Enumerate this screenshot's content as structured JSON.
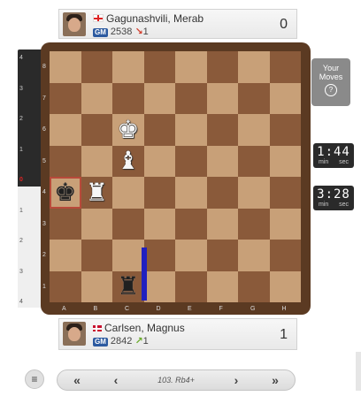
{
  "players": {
    "top": {
      "name": "Gagunashvili, Merab",
      "title": "GM",
      "rating": "2538",
      "rating_change": "1",
      "rating_dir": "down",
      "score": "0",
      "flag": "georgia"
    },
    "bottom": {
      "name": "Carlsen, Magnus",
      "title": "GM",
      "rating": "2842",
      "rating_change": "1",
      "rating_dir": "up",
      "score": "1",
      "flag": "norway"
    }
  },
  "eval_bar": {
    "marks": [
      "4",
      "3",
      "2",
      "1",
      "0",
      "1",
      "2",
      "3",
      "4"
    ],
    "white_fraction": 0.47
  },
  "board": {
    "ranks": [
      "8",
      "7",
      "6",
      "5",
      "4",
      "3",
      "2",
      "1"
    ],
    "files": [
      "A",
      "B",
      "C",
      "D",
      "E",
      "F",
      "G",
      "H"
    ],
    "pieces": [
      {
        "square": "c6",
        "glyph": "♚",
        "side": "w",
        "name": "white-king"
      },
      {
        "square": "c5",
        "glyph": "♝",
        "side": "w",
        "name": "white-bishop"
      },
      {
        "square": "a4",
        "glyph": "♚",
        "side": "b",
        "name": "black-king"
      },
      {
        "square": "b4",
        "glyph": "♜",
        "side": "w",
        "name": "white-rook"
      },
      {
        "square": "c1",
        "glyph": "♜",
        "side": "b",
        "name": "black-rook"
      }
    ],
    "highlighted": "a4"
  },
  "your_moves": {
    "label": "Your Moves",
    "help": "?"
  },
  "clocks": [
    {
      "time": "1:44",
      "min": "min",
      "sec": "sec"
    },
    {
      "time": "3:28",
      "min": "min",
      "sec": "sec"
    }
  ],
  "navigation": {
    "first": "«",
    "prev": "‹",
    "move": "103. Rb4+",
    "next": "›",
    "last": "»",
    "menu": "≡"
  },
  "colors": {
    "light_square": "#c8a078",
    "dark_square": "#8a5a3a",
    "board_frame": "#5b3a22",
    "move_arrow": "#2020c0"
  }
}
